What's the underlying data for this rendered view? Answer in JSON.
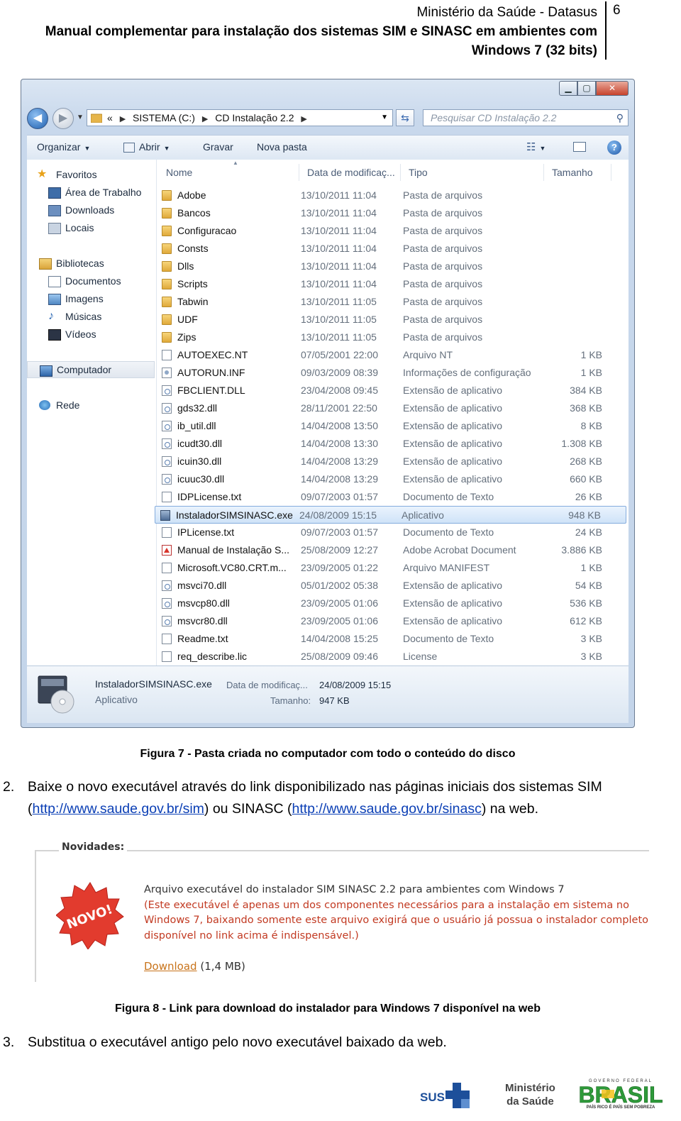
{
  "header": {
    "line1": "Ministério da Saúde - Datasus",
    "line2": "Manual complementar para instalação dos sistemas SIM e SINASC em ambientes com",
    "line3": "Windows 7 (32 bits)",
    "page_number": "6"
  },
  "explorer": {
    "address": {
      "root": "«",
      "part1": "SISTEMA (C:)",
      "part2": "CD Instalação 2.2"
    },
    "search_placeholder": "Pesquisar CD Instalação 2.2",
    "toolbar": {
      "organize": "Organizar",
      "open": "Abrir",
      "burn": "Gravar",
      "new_folder": "Nova pasta"
    },
    "nav": {
      "favorites": "Favoritos",
      "desktop": "Área de Trabalho",
      "downloads": "Downloads",
      "places": "Locais",
      "libraries": "Bibliotecas",
      "documents": "Documentos",
      "images": "Imagens",
      "music": "Músicas",
      "videos": "Vídeos",
      "computer": "Computador",
      "network": "Rede"
    },
    "columns": {
      "name": "Nome",
      "date": "Data de modificaç...",
      "type": "Tipo",
      "size": "Tamanho"
    },
    "files": [
      {
        "icon": "folder",
        "name": "Adobe",
        "date": "13/10/2011 11:04",
        "type": "Pasta de arquivos",
        "size": ""
      },
      {
        "icon": "folder",
        "name": "Bancos",
        "date": "13/10/2011 11:04",
        "type": "Pasta de arquivos",
        "size": ""
      },
      {
        "icon": "folder",
        "name": "Configuracao",
        "date": "13/10/2011 11:04",
        "type": "Pasta de arquivos",
        "size": ""
      },
      {
        "icon": "folder",
        "name": "Consts",
        "date": "13/10/2011 11:04",
        "type": "Pasta de arquivos",
        "size": ""
      },
      {
        "icon": "folder",
        "name": "Dlls",
        "date": "13/10/2011 11:04",
        "type": "Pasta de arquivos",
        "size": ""
      },
      {
        "icon": "folder",
        "name": "Scripts",
        "date": "13/10/2011 11:04",
        "type": "Pasta de arquivos",
        "size": ""
      },
      {
        "icon": "folder",
        "name": "Tabwin",
        "date": "13/10/2011 11:05",
        "type": "Pasta de arquivos",
        "size": ""
      },
      {
        "icon": "folder",
        "name": "UDF",
        "date": "13/10/2011 11:05",
        "type": "Pasta de arquivos",
        "size": ""
      },
      {
        "icon": "folder",
        "name": "Zips",
        "date": "13/10/2011 11:05",
        "type": "Pasta de arquivos",
        "size": ""
      },
      {
        "icon": "doc",
        "name": "AUTOEXEC.NT",
        "date": "07/05/2001 22:00",
        "type": "Arquivo NT",
        "size": "1 KB"
      },
      {
        "icon": "inf",
        "name": "AUTORUN.INF",
        "date": "09/03/2009 08:39",
        "type": "Informações de configuração",
        "size": "1 KB"
      },
      {
        "icon": "dll",
        "name": "FBCLIENT.DLL",
        "date": "23/04/2008 09:45",
        "type": "Extensão de aplicativo",
        "size": "384 KB"
      },
      {
        "icon": "dll",
        "name": "gds32.dll",
        "date": "28/11/2001 22:50",
        "type": "Extensão de aplicativo",
        "size": "368 KB"
      },
      {
        "icon": "dll",
        "name": "ib_util.dll",
        "date": "14/04/2008 13:50",
        "type": "Extensão de aplicativo",
        "size": "8 KB"
      },
      {
        "icon": "dll",
        "name": "icudt30.dll",
        "date": "14/04/2008 13:30",
        "type": "Extensão de aplicativo",
        "size": "1.308 KB"
      },
      {
        "icon": "dll",
        "name": "icuin30.dll",
        "date": "14/04/2008 13:29",
        "type": "Extensão de aplicativo",
        "size": "268 KB"
      },
      {
        "icon": "dll",
        "name": "icuuc30.dll",
        "date": "14/04/2008 13:29",
        "type": "Extensão de aplicativo",
        "size": "660 KB"
      },
      {
        "icon": "doc",
        "name": "IDPLicense.txt",
        "date": "09/07/2003 01:57",
        "type": "Documento de Texto",
        "size": "26 KB"
      },
      {
        "icon": "exe",
        "name": "InstaladorSIMSINASC.exe",
        "date": "24/08/2009 15:15",
        "type": "Aplicativo",
        "size": "948 KB",
        "selected": true
      },
      {
        "icon": "doc",
        "name": "IPLicense.txt",
        "date": "09/07/2003 01:57",
        "type": "Documento de Texto",
        "size": "24 KB"
      },
      {
        "icon": "pdf",
        "name": "Manual de Instalação S...",
        "date": "25/08/2009 12:27",
        "type": "Adobe Acrobat Document",
        "size": "3.886 KB"
      },
      {
        "icon": "doc",
        "name": "Microsoft.VC80.CRT.m...",
        "date": "23/09/2005 01:22",
        "type": "Arquivo MANIFEST",
        "size": "1 KB"
      },
      {
        "icon": "dll",
        "name": "msvci70.dll",
        "date": "05/01/2002 05:38",
        "type": "Extensão de aplicativo",
        "size": "54 KB"
      },
      {
        "icon": "dll",
        "name": "msvcp80.dll",
        "date": "23/09/2005 01:06",
        "type": "Extensão de aplicativo",
        "size": "536 KB"
      },
      {
        "icon": "dll",
        "name": "msvcr80.dll",
        "date": "23/09/2005 01:06",
        "type": "Extensão de aplicativo",
        "size": "612 KB"
      },
      {
        "icon": "doc",
        "name": "Readme.txt",
        "date": "14/04/2008 15:25",
        "type": "Documento de Texto",
        "size": "3 KB"
      },
      {
        "icon": "doc",
        "name": "req_describe.lic",
        "date": "25/08/2009 09:46",
        "type": "License",
        "size": "3 KB"
      }
    ],
    "details": {
      "name": "InstaladorSIMSINASC.exe",
      "kind": "Aplicativo",
      "date_label": "Data de modificaç...",
      "date_value": "24/08/2009 15:15",
      "size_label": "Tamanho:",
      "size_value": "947 KB"
    }
  },
  "figure7_caption": "Figura 7 - Pasta criada no computador com todo o conteúdo do disco",
  "step2": {
    "number": "2.",
    "text_a": "Baixe o novo executável através do link disponibilizado nas páginas iniciais dos sistemas SIM (",
    "link_sim": "http://www.saude.gov.br/sim",
    "text_b": ") ou SINASC (",
    "link_sinasc": "http://www.saude.gov.br/sinasc",
    "text_c": ") na web."
  },
  "novidades": {
    "title": "Novidades:",
    "badge": "NOVO!",
    "line1": "Arquivo executável do instalador SIM SINASC 2.2 para ambientes com Windows 7",
    "line2": "(Este executável é apenas um dos componentes necessários para a instalação em sistema no Windows 7, baixando somente este arquivo exigirá que o usuário já possua o instalador completo disponível no link acima é indispensável.)",
    "download_label": "Download",
    "download_size": "(1,4 MB)"
  },
  "figure8_caption": "Figura 8 - Link para download do instalador para Windows 7 disponível na web",
  "step3": {
    "number": "3.",
    "text": "Substitua o executável antigo pelo novo executável baixado da web."
  },
  "footer": {
    "sus": "SUS",
    "ministry_line1": "Ministério",
    "ministry_line2": "da Saúde",
    "brasil_top": "GOVERNO FEDERAL",
    "brasil": "BRASIL",
    "brasil_slogan": "PAÍS RICO É PAÍS SEM POBREZA"
  },
  "colors": {
    "link": "#0b3fb5",
    "novidades_red": "#c23a22",
    "download_orange": "#c8731a",
    "selection": "#cfe3f8"
  }
}
